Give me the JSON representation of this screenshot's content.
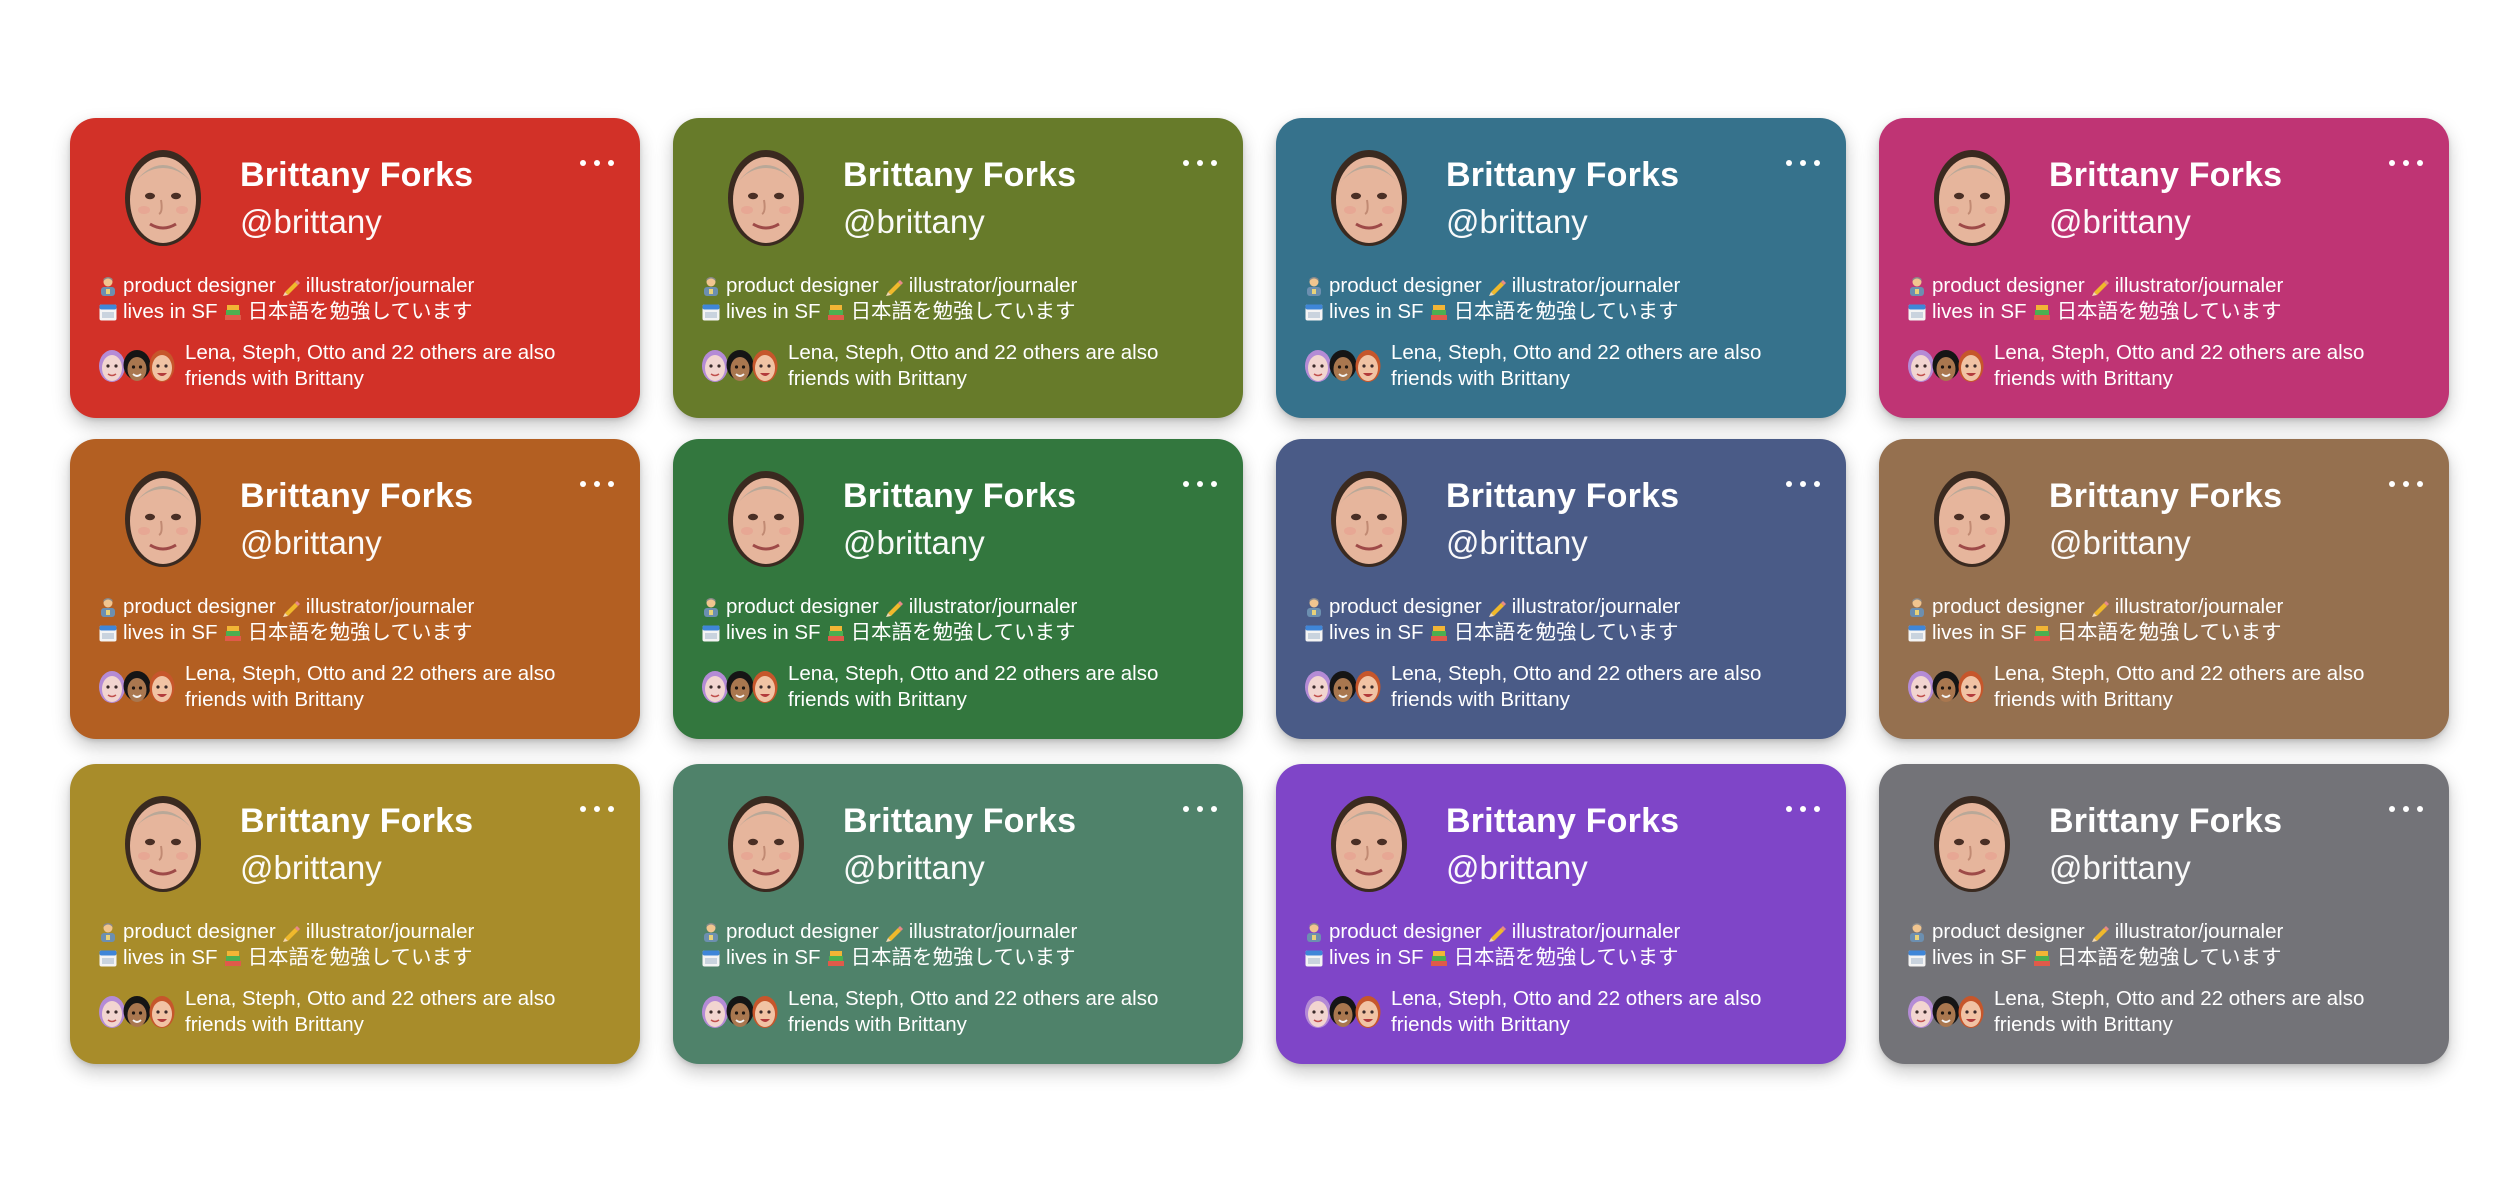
{
  "cards": [
    {
      "name": "Brittany Forks",
      "handle": "@brittany",
      "bio_role": "product designer",
      "bio_role2": "illustrator/journaler",
      "bio_location": "lives in SF",
      "bio_study": "日本語を勉強しています",
      "friends_text": "Lena, Steph, Otto and 22 others are also friends with Brittany",
      "color": "#d23128"
    },
    {
      "name": "Brittany Forks",
      "handle": "@brittany",
      "bio_role": "product designer",
      "bio_role2": "illustrator/journaler",
      "bio_location": "lives in SF",
      "bio_study": "日本語を勉強しています",
      "friends_text": "Lena, Steph, Otto and 22 others are also friends with Brittany",
      "color": "#677b2a"
    },
    {
      "name": "Brittany Forks",
      "handle": "@brittany",
      "bio_role": "product designer",
      "bio_role2": "illustrator/journaler",
      "bio_location": "lives in SF",
      "bio_study": "日本語を勉強しています",
      "friends_text": "Lena, Steph, Otto and 22 others are also friends with Brittany",
      "color": "#36728c"
    },
    {
      "name": "Brittany Forks",
      "handle": "@brittany",
      "bio_role": "product designer",
      "bio_role2": "illustrator/journaler",
      "bio_location": "lives in SF",
      "bio_study": "日本語を勉強しています",
      "friends_text": "Lena, Steph, Otto and 22 others are also friends with Brittany",
      "color": "#bf3474"
    },
    {
      "name": "Brittany Forks",
      "handle": "@brittany",
      "bio_role": "product designer",
      "bio_role2": "illustrator/journaler",
      "bio_location": "lives in SF",
      "bio_study": "日本語を勉強しています",
      "friends_text": "Lena, Steph, Otto and 22 others are also friends with Brittany",
      "color": "#b35f22"
    },
    {
      "name": "Brittany Forks",
      "handle": "@brittany",
      "bio_role": "product designer",
      "bio_role2": "illustrator/journaler",
      "bio_location": "lives in SF",
      "bio_study": "日本語を勉強しています",
      "friends_text": "Lena, Steph, Otto and 22 others are also friends with Brittany",
      "color": "#33773e"
    },
    {
      "name": "Brittany Forks",
      "handle": "@brittany",
      "bio_role": "product designer",
      "bio_role2": "illustrator/journaler",
      "bio_location": "lives in SF",
      "bio_study": "日本語を勉強しています",
      "friends_text": "Lena, Steph, Otto and 22 others are also friends with Brittany",
      "color": "#4a5b87"
    },
    {
      "name": "Brittany Forks",
      "handle": "@brittany",
      "bio_role": "product designer",
      "bio_role2": "illustrator/journaler",
      "bio_location": "lives in SF",
      "bio_study": "日本語を勉強しています",
      "friends_text": "Lena, Steph, Otto and 22 others are also friends with Brittany",
      "color": "#95704f"
    },
    {
      "name": "Brittany Forks",
      "handle": "@brittany",
      "bio_role": "product designer",
      "bio_role2": "illustrator/journaler",
      "bio_location": "lives in SF",
      "bio_study": "日本語を勉強しています",
      "friends_text": "Lena, Steph, Otto and 22 others are also friends with Brittany",
      "color": "#a88c2a"
    },
    {
      "name": "Brittany Forks",
      "handle": "@brittany",
      "bio_role": "product designer",
      "bio_role2": "illustrator/journaler",
      "bio_location": "lives in SF",
      "bio_study": "日本語を勉強しています",
      "friends_text": "Lena, Steph, Otto and 22 others are also friends with Brittany",
      "color": "#4f826a"
    },
    {
      "name": "Brittany Forks",
      "handle": "@brittany",
      "bio_role": "product designer",
      "bio_role2": "illustrator/journaler",
      "bio_location": "lives in SF",
      "bio_study": "日本語を勉強しています",
      "friends_text": "Lena, Steph, Otto and 22 others are also friends with Brittany",
      "color": "#7f45c8"
    },
    {
      "name": "Brittany Forks",
      "handle": "@brittany",
      "bio_role": "product designer",
      "bio_role2": "illustrator/journaler",
      "bio_location": "lives in SF",
      "bio_study": "日本語を勉強しています",
      "friends_text": "Lena, Steph, Otto and 22 others are also friends with Brittany",
      "color": "#737378"
    }
  ],
  "icons": {
    "more": "more-options-icon",
    "role": "person-emoji-icon",
    "role2": "pencil-emoji-icon",
    "location": "calendar-emoji-icon",
    "study": "books-emoji-icon"
  }
}
